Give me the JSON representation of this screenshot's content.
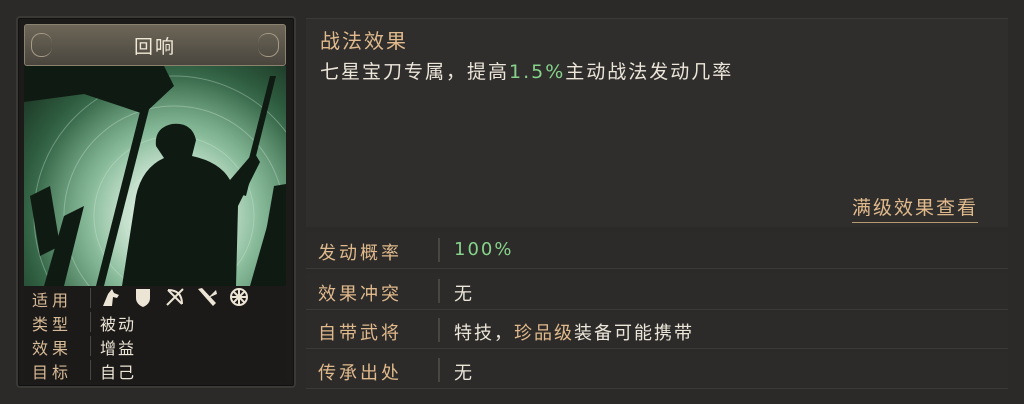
{
  "card": {
    "title": "回响",
    "info": [
      {
        "label": "适用",
        "icons": [
          "cavalry-icon",
          "shield-icon",
          "bow-icon",
          "spear-icon",
          "vehicle-icon"
        ]
      },
      {
        "label": "类型",
        "value": "被动"
      },
      {
        "label": "效果",
        "value": "增益"
      },
      {
        "label": "目标",
        "value": "自己"
      }
    ]
  },
  "effect": {
    "title": "战法效果",
    "desc_prefix": "七星宝刀专属，提高",
    "desc_highlight": "1.5%",
    "desc_suffix": "主动战法发动几率",
    "full_link": "满级效果查看"
  },
  "rows": [
    {
      "label": "发动概率",
      "value": "100%"
    },
    {
      "label": "效果冲突",
      "value": "无"
    },
    {
      "label": "自带武将",
      "value_prefix": "特技，",
      "value_highlight": "珍品级",
      "value_suffix": "装备可能携带"
    },
    {
      "label": "传承出处",
      "value": "无"
    }
  ],
  "colors": {
    "accent": "#e0b98c",
    "highlight_green": "#86d28a",
    "text": "#ece6da"
  }
}
